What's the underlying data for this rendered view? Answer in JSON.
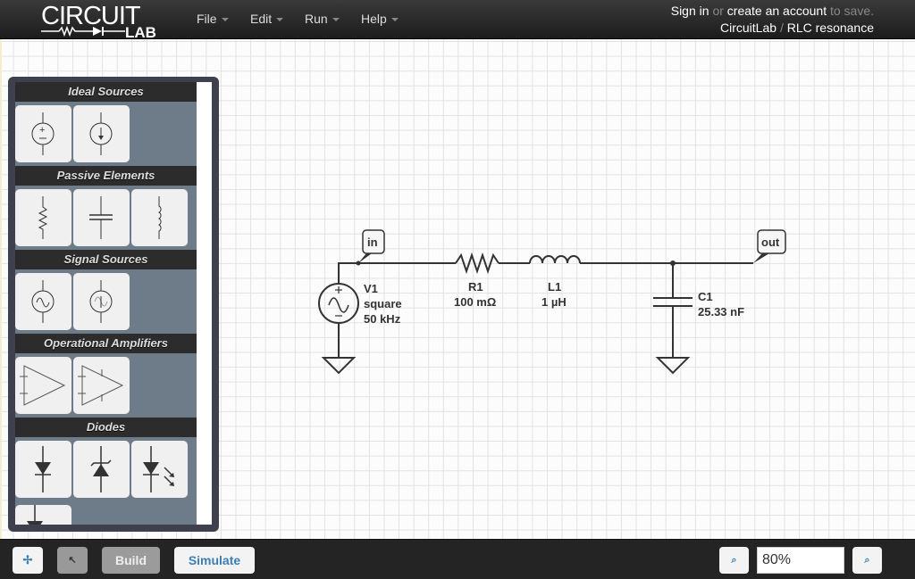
{
  "header": {
    "logo_text": "CIRCUIT LAB",
    "menus": [
      {
        "label": "File"
      },
      {
        "label": "Edit"
      },
      {
        "label": "Run"
      },
      {
        "label": "Help"
      }
    ],
    "account": {
      "sign_in": "Sign in",
      "or": "or",
      "create": "create an account",
      "to_save": "to save."
    },
    "breadcrumb": {
      "site": "CircuitLab",
      "sep": "/",
      "title": "RLC resonance"
    }
  },
  "palette": {
    "sections": [
      {
        "title": "Ideal Sources",
        "items": [
          "voltage-source",
          "current-source"
        ]
      },
      {
        "title": "Passive Elements",
        "items": [
          "resistor",
          "capacitor",
          "inductor"
        ]
      },
      {
        "title": "Signal Sources",
        "items": [
          "signal-voltage-source",
          "signal-current-source"
        ]
      },
      {
        "title": "Operational Amplifiers",
        "items": [
          "opamp",
          "opamp-powered"
        ]
      },
      {
        "title": "Diodes",
        "items": [
          "diode",
          "zener-diode",
          "led",
          "schottky-diode"
        ]
      }
    ]
  },
  "circuit": {
    "labels": {
      "in": "in",
      "out": "out"
    },
    "V1": {
      "name": "V1",
      "type": "square",
      "freq": "50 kHz"
    },
    "R1": {
      "name": "R1",
      "value": "100 mΩ"
    },
    "L1": {
      "name": "L1",
      "value": "1 µH"
    },
    "C1": {
      "name": "C1",
      "value": "25.33 nF"
    }
  },
  "toolbar": {
    "pan_icon": "move-icon",
    "select_icon": "cursor-icon",
    "build": "Build",
    "simulate": "Simulate",
    "zoom_value": "80%",
    "zoom_out_icon": "zoom-out-icon",
    "zoom_in_icon": "zoom-in-icon"
  },
  "colors": {
    "accent": "#3b7fb4",
    "header": "#2a2a2a",
    "palette": "#3e404d",
    "wire": "#333333"
  }
}
